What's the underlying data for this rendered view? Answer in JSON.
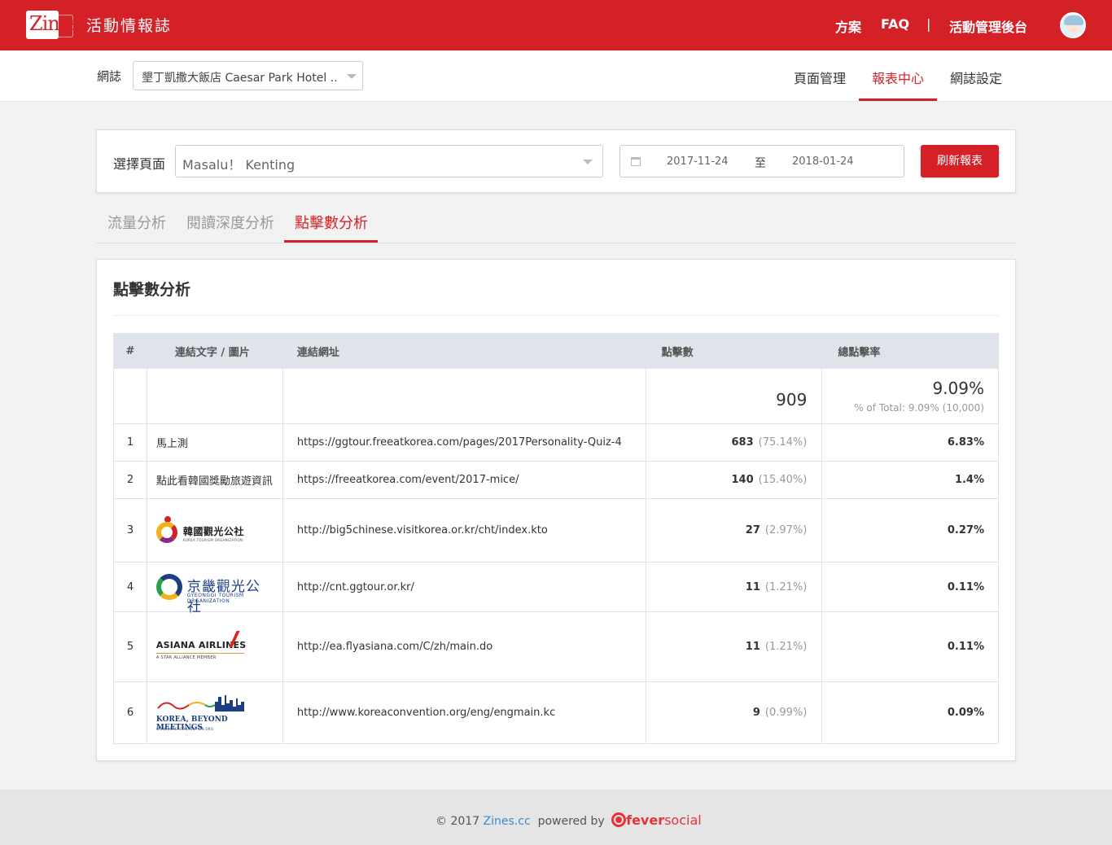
{
  "brand": {
    "logo_text": "Zines",
    "subtitle": "活動情報誌"
  },
  "topnav": {
    "plans": "方案",
    "faq": "FAQ",
    "separator": "|",
    "admin": "活動管理後台"
  },
  "subheader": {
    "zine_label": "網誌",
    "zine_selected": "墾丁凱撒大飯店 Caesar Park Hotel ...",
    "tabs": [
      {
        "label": "頁面管理",
        "active": false
      },
      {
        "label": "報表中心",
        "active": true
      },
      {
        "label": "網誌設定",
        "active": false
      }
    ]
  },
  "filter": {
    "page_label": "選擇頁面",
    "page_selected": "Masalu！ Kenting",
    "date_from": "2017-11-24",
    "date_to_label": "至",
    "date_to": "2018-01-24",
    "refresh_label": "刷新報表"
  },
  "analysis_tabs": [
    {
      "label": "流量分析",
      "active": false
    },
    {
      "label": "閱讀深度分析",
      "active": false
    },
    {
      "label": "點擊數分析",
      "active": true
    }
  ],
  "report": {
    "title": "點擊數分析",
    "columns": [
      "#",
      "連結文字 / 圖片",
      "連結網址",
      "點擊數",
      "總點擊率"
    ],
    "summary": {
      "clicks": "909",
      "rate": "9.09%",
      "rate_sub": "% of Total: 9.09% (10,000)"
    },
    "rows": [
      {
        "idx": "1",
        "text": "馬上測",
        "url": "https://ggtour.freeatkorea.com/pages/2017Personality-Quiz-4",
        "clicks": "683",
        "pct": "(75.14%)",
        "rate": "6.83%"
      },
      {
        "idx": "2",
        "text": "點此看韓國獎勵旅遊資訊",
        "url": "https://freeatkorea.com/event/2017-mice/",
        "clicks": "140",
        "pct": "(15.40%)",
        "rate": "1.4%"
      },
      {
        "idx": "3",
        "logo_title": "韓國觀光公社",
        "logo_sub": "KOREA TOURISM ORGANIZATION",
        "url": "http://big5chinese.visitkorea.or.kr/cht/index.kto",
        "clicks": "27",
        "pct": "(2.97%)",
        "rate": "0.27%"
      },
      {
        "idx": "4",
        "logo_title": "京畿觀光公社",
        "logo_sub": "GYEONGGI TOURISM ORGANIZATION",
        "url": "http://cnt.ggtour.or.kr/",
        "clicks": "11",
        "pct": "(1.21%)",
        "rate": "0.11%"
      },
      {
        "idx": "5",
        "logo_title": "ASIANA AIRLINES",
        "logo_sub": "A STAR ALLIANCE MEMBER",
        "url": "http://ea.flyasiana.com/C/zh/main.do",
        "clicks": "11",
        "pct": "(1.21%)",
        "rate": "0.11%"
      },
      {
        "idx": "6",
        "logo_title": "KOREA, BEYOND MEETINGS",
        "logo_sub": "WWW.KOREACONVENTION.ORG",
        "url": "http://www.koreaconvention.org/eng/engmain.kc",
        "clicks": "9",
        "pct": "(0.99%)",
        "rate": "0.09%"
      }
    ]
  },
  "footer": {
    "copyright": "© 2017",
    "site_link": "Zines.cc",
    "powered_by": "powered by",
    "partner_a": "fever",
    "partner_b": "social"
  },
  "colors": {
    "brand_red": "#d42027",
    "link_blue": "#3a8ad8",
    "table_header": "#dfe4ea"
  }
}
